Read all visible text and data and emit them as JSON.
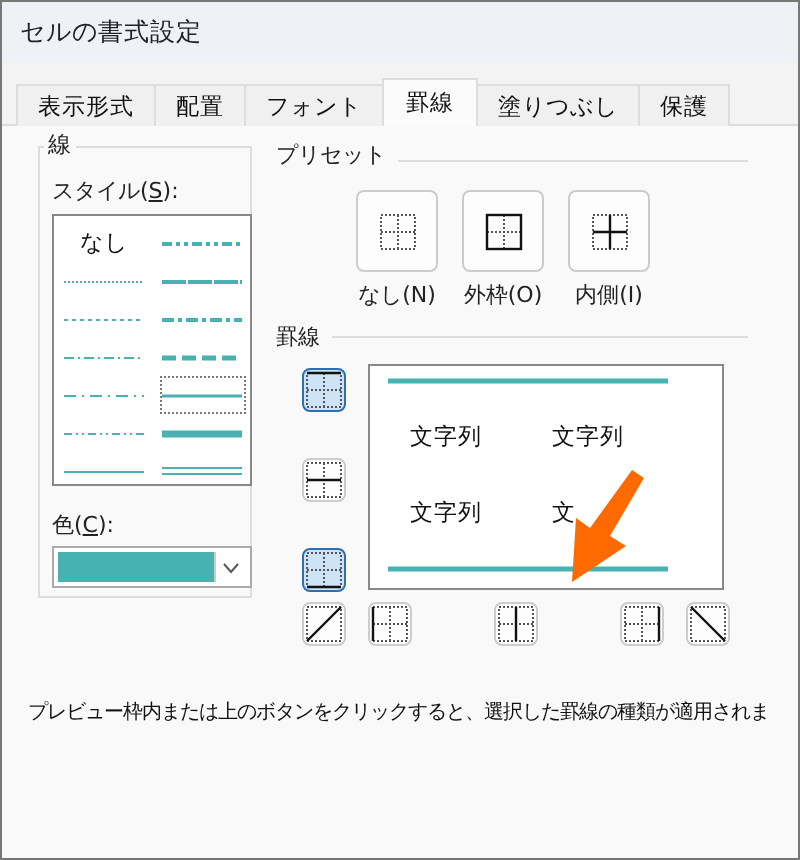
{
  "window": {
    "title": "セルの書式設定"
  },
  "tabs": [
    {
      "label": "表示形式",
      "selected": false
    },
    {
      "label": "配置",
      "selected": false
    },
    {
      "label": "フォント",
      "selected": false
    },
    {
      "label": "罫線",
      "selected": true
    },
    {
      "label": "塗りつぶし",
      "selected": false
    },
    {
      "label": "保護",
      "selected": false
    }
  ],
  "line_group": {
    "title": "線",
    "style_label": "スタイル(**S**):",
    "color_label": "色(**C**):",
    "color": "#48b2b2",
    "styles": [
      {
        "kind": "none",
        "label": "なし",
        "selected": false
      },
      {
        "kind": "dashdotdot",
        "selected": false
      },
      {
        "kind": "hair",
        "selected": false
      },
      {
        "kind": "slanted",
        "selected": false
      },
      {
        "kind": "dotted",
        "selected": false
      },
      {
        "kind": "dashdot-medium",
        "selected": false
      },
      {
        "kind": "dashdot",
        "selected": false
      },
      {
        "kind": "dashed-medium",
        "selected": false
      },
      {
        "kind": "dashdot-long",
        "selected": false
      },
      {
        "kind": "thin",
        "selected": true
      },
      {
        "kind": "dashdotdot-thin",
        "selected": false
      },
      {
        "kind": "thick",
        "selected": false
      },
      {
        "kind": "solid",
        "selected": false
      },
      {
        "kind": "double",
        "selected": false
      }
    ]
  },
  "preset": {
    "title": "プリセット",
    "buttons": [
      {
        "kind": "none",
        "label": "なし(N)"
      },
      {
        "kind": "outline",
        "label": "外枠(O)"
      },
      {
        "kind": "inside",
        "label": "内側(I)"
      }
    ]
  },
  "border": {
    "title": "罫線",
    "side_buttons": [
      {
        "kind": "top",
        "selected": true
      },
      {
        "kind": "middle",
        "selected": false
      },
      {
        "kind": "bottom",
        "selected": true
      }
    ],
    "bottom_buttons": [
      {
        "kind": "diag-up",
        "selected": false
      },
      {
        "kind": "left",
        "selected": false
      },
      {
        "kind": "center",
        "selected": false
      },
      {
        "kind": "right",
        "selected": false
      },
      {
        "kind": "diag-down",
        "selected": false
      }
    ],
    "cells": [
      "文字列",
      "文字列",
      "文字列",
      "文"
    ]
  },
  "description": "プレビュー枠内または上のボタンをクリックすると、選択した罫線の種類が適用されま"
}
